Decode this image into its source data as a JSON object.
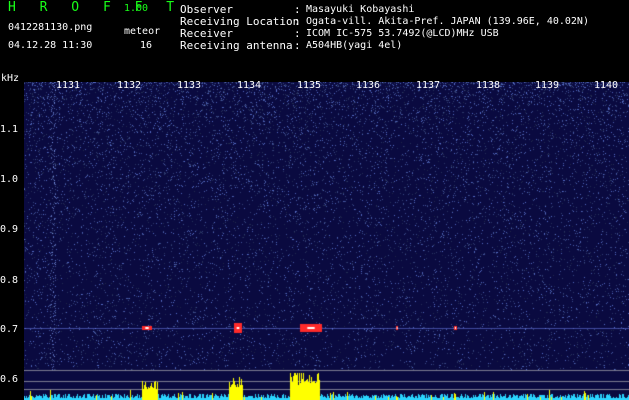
{
  "header": {
    "title": "H R O F F T",
    "version": "1.00",
    "filename": "0412281130.png",
    "datetime": "04.12.28 11:30",
    "meteor_label": "meteor",
    "meteor_count": "16"
  },
  "meta": [
    {
      "key": "Observer",
      "sep": ":",
      "value": "Masayuki Kobayashi"
    },
    {
      "key": "Receiving Location",
      "sep": ":",
      "value": "Ogata-vill. Akita-Pref. JAPAN (139.96E, 40.02N)"
    },
    {
      "key": "Receiver",
      "sep": ":",
      "value": "ICOM IC-575 53.7492(@LCD)MHz USB"
    },
    {
      "key": "Receiving antenna",
      "sep": ":",
      "value": "A504HB(yagi 4el)"
    }
  ],
  "spectrogram": {
    "y_unit": "kHz",
    "y_ticks": [
      "1.1",
      "1.0",
      "0.9",
      "0.8",
      "0.7",
      "0.6"
    ],
    "x_ticks": [
      "1131",
      "1132",
      "1133",
      "1134",
      "1135",
      "1136",
      "1137",
      "1138",
      "1139",
      "1140"
    ],
    "colors": {
      "background": "#0a0a40",
      "noise": "#3a4aff",
      "echo": "#ff2a2a",
      "level": "#ffff00",
      "baseline": "#2ad4ff"
    }
  }
}
